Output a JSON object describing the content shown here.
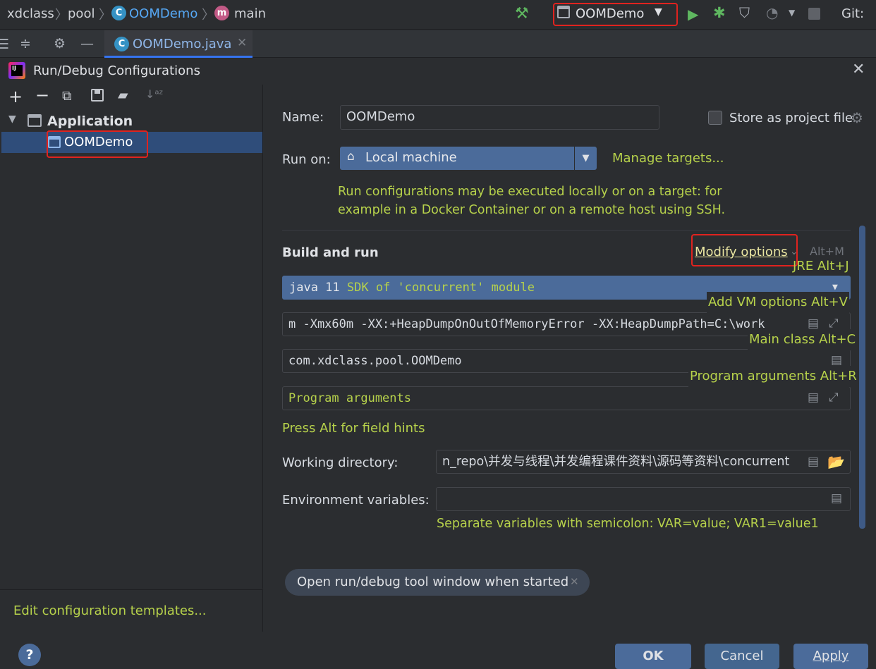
{
  "topbar": {
    "crumbs": [
      "xdclass",
      "pool",
      "OOMDemo",
      "main"
    ],
    "run_config": "OOMDemo",
    "git_label": "Git:"
  },
  "tabbar": {
    "file_tab": "OOMDemo.java"
  },
  "dialog": {
    "title": "Run/Debug Configurations",
    "tree": {
      "group": "Application",
      "item": "OOMDemo"
    },
    "edit_templates": "Edit configuration templates...",
    "name_label": "Name:",
    "name_value": "OOMDemo",
    "store_label": "Store as project file",
    "run_on_label": "Run on:",
    "run_on_value": "Local machine",
    "manage_targets": "Manage targets...",
    "run_on_hint_1": "Run configurations may be executed locally or on a target: for",
    "run_on_hint_2": "example in a Docker Container or on a remote host using SSH.",
    "build_run_heading": "Build and run",
    "modify_options": "Modify options",
    "modify_shortcut": "Alt+M",
    "sdk_value": "java 11",
    "sdk_detail": "SDK of 'concurrent' module",
    "vm_options_value": "m -Xmx60m -XX:+HeapDumpOnOutOfMemoryError -XX:HeapDumpPath=C:\\work",
    "main_class_value": "com.xdclass.pool.OOMDemo",
    "program_args_placeholder": "Program arguments",
    "field_hints": "Press Alt for field hints",
    "working_dir_label": "Working directory:",
    "working_dir_value": "n_repo\\并发与线程\\并发编程课件资料\\源码等资料\\concurrent",
    "env_label": "Environment variables:",
    "env_hint": "Separate variables with semicolon: VAR=value; VAR1=value1",
    "chip_label": "Open run/debug tool window when started",
    "popup": {
      "jre": "JRE Alt+J",
      "add_vm": "Add VM options Alt+V",
      "main_class": "Main class Alt+C",
      "program_args": "Program arguments Alt+R"
    },
    "buttons": {
      "ok": "OK",
      "cancel": "Cancel",
      "apply": "Apply"
    }
  },
  "colors": {
    "accent": "#4b6b9a",
    "hint": "#b7d24b",
    "highlight_box": "#e0231f",
    "selection": "#2f4d7a"
  }
}
